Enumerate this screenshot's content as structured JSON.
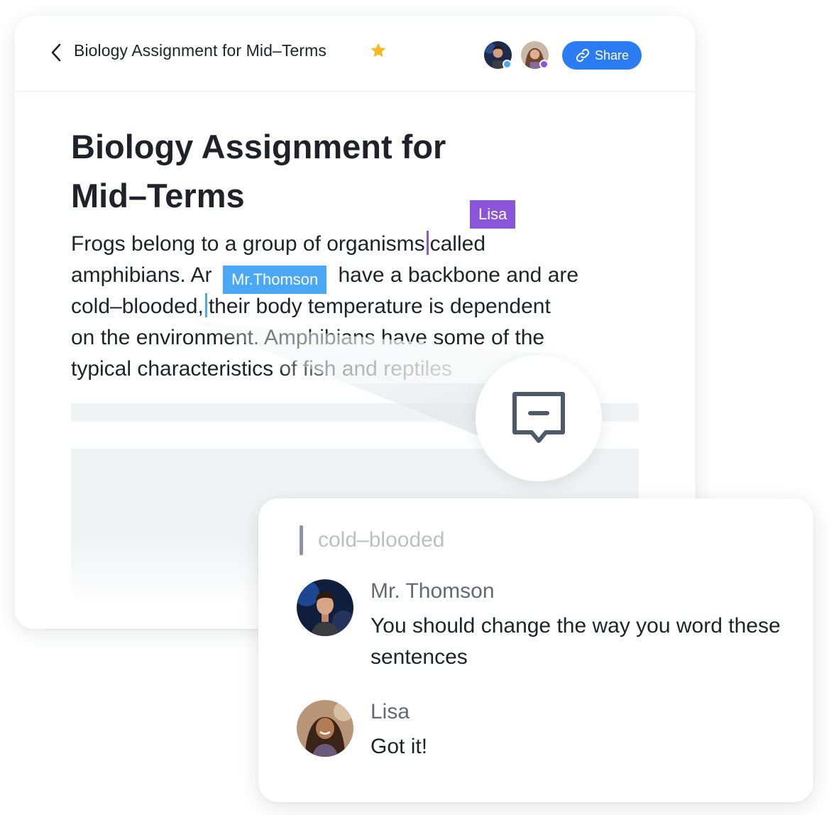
{
  "header": {
    "doc_title": "Biology Assignment for Mid–Terms",
    "share_label": "Share",
    "star_color": "#f7ba1e"
  },
  "collaborators": [
    {
      "icon": "avatar",
      "status_color": "#4aa8f7"
    },
    {
      "icon": "avatar",
      "status_color": "#8a55d8"
    }
  ],
  "document": {
    "title_line1": "Biology Assignment for",
    "title_line2": "Mid–Terms",
    "body": {
      "l1_a": "Frogs belong to a group of organisms",
      "l1_b": "called",
      "l2_a": "amphibians. Ar",
      "l2_b": "have a backbone and are",
      "l3_a": "cold–blooded,",
      "l3_b": "their body temperature is dependent",
      "l4": "on the environment. Amphibians have some of the",
      "l5": "typical characteristics of fish and reptiles"
    },
    "cursors": {
      "lisa": {
        "label": "Lisa",
        "color": "#8a55d8"
      },
      "thomson": {
        "label": "Mr.Thomson",
        "color": "#4aa8f7"
      }
    }
  },
  "comment_button": {
    "icon": "comment-icon"
  },
  "comments": {
    "quote": "cold–blooded",
    "items": [
      {
        "author": "Mr. Thomson",
        "text": "You should change the way you word these sentences"
      },
      {
        "author": "Lisa",
        "text": "Got it!"
      }
    ]
  },
  "colors": {
    "accent": "#2b7bf2",
    "lisa": "#8a55d8",
    "thomson": "#4aa8f7"
  }
}
